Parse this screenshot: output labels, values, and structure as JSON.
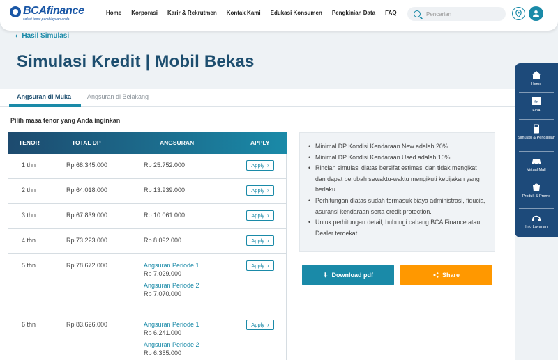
{
  "brand": {
    "name": "BCAfinance",
    "tagline": "solusi tepat pembiayaan anda"
  },
  "nav": {
    "items": [
      "Home",
      "Korporasi",
      "Karir & Rekrutmen",
      "Kontak Kami",
      "Edukasi Konsumen",
      "Pengkinian Data",
      "FAQ"
    ]
  },
  "search": {
    "placeholder": "Pencarian"
  },
  "breadcrumb": {
    "label": "Hasil Simulasi"
  },
  "page": {
    "title": "Simulasi Kredit | Mobil Bekas"
  },
  "tabs": {
    "active": "Angsuran di Muka",
    "inactive": "Angsuran di Belakang"
  },
  "instruction": "Pilih masa tenor yang Anda inginkan",
  "table": {
    "headers": {
      "tenor": "TENOR",
      "dp": "TOTAL DP",
      "angsuran": "ANGSURAN",
      "apply": "APPLY"
    },
    "apply_label": "Apply",
    "rows": [
      {
        "tenor": "1 thn",
        "dp": "Rp 68.345.000",
        "angsuran": "Rp 25.752.000"
      },
      {
        "tenor": "2 thn",
        "dp": "Rp 64.018.000",
        "angsuran": "Rp 13.939.000"
      },
      {
        "tenor": "3 thn",
        "dp": "Rp 67.839.000",
        "angsuran": "Rp 10.061.000"
      },
      {
        "tenor": "4 thn",
        "dp": "Rp 73.223.000",
        "angsuran": "Rp 8.092.000"
      },
      {
        "tenor": "5 thn",
        "dp": "Rp 78.672.000",
        "periods": [
          {
            "label": "Angsuran Periode 1",
            "amount": "Rp 7.029.000"
          },
          {
            "label": "Angsuran Periode 2",
            "amount": "Rp 7.070.000"
          }
        ]
      },
      {
        "tenor": "6 thn",
        "dp": "Rp 83.626.000",
        "periods": [
          {
            "label": "Angsuran Periode 1",
            "amount": "Rp 6.241.000"
          },
          {
            "label": "Angsuran Periode 2",
            "amount": "Rp 6.355.000"
          }
        ]
      }
    ]
  },
  "info": {
    "items": [
      "Minimal DP Kondisi Kendaraan New adalah 20%",
      "Minimal DP Kondisi Kendaraan Used adalah 10%",
      "Rincian simulasi diatas bersifat estimasi dan tidak mengikat dan dapat berubah sewaktu-waktu mengikuti kebijakan yang berlaku.",
      "Perhitungan diatas sudah termasuk biaya administrasi, fiducia, asuransi kendaraan serta credit protection.",
      "Untuk perhitungan detail, hubungi cabang BCA Finance atau Dealer terdekat."
    ]
  },
  "actions": {
    "download": "Download pdf",
    "share": "Share"
  },
  "sidebar": {
    "items": [
      "Home",
      "FinA",
      "Simulasi & Pengajuan",
      "Virtual Mall",
      "Produk & Promo",
      "Info Layanan"
    ],
    "fina_icon_text": "fin"
  },
  "colors": {
    "primary": "#1a8aa8",
    "navy": "#1d4a7a",
    "title": "#1d4e6f",
    "accent": "#ff9800"
  }
}
